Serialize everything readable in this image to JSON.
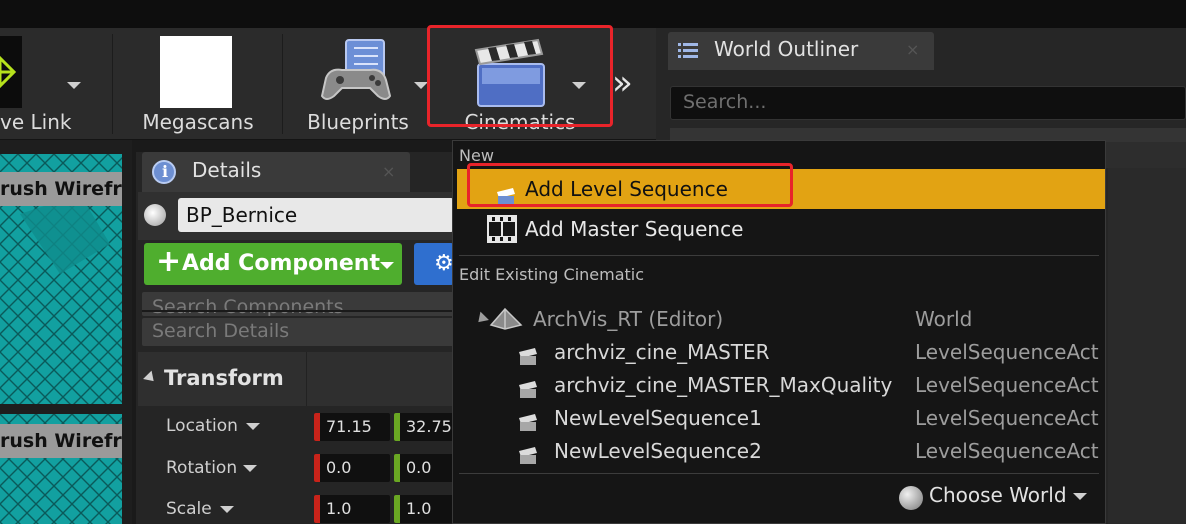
{
  "toolbar": {
    "live_link_label": "ve Link",
    "megascans_label": "Megascans",
    "blueprints_label": "Blueprints",
    "cinematics_label": "Cinematics",
    "overflow_glyph": "»"
  },
  "world_outliner": {
    "tab_label": "World Outliner",
    "search_placeholder": "Search...",
    "close_glyph": "×"
  },
  "viewport": {
    "label_1": "rush Wirefram",
    "label_2": "rush Wirefra"
  },
  "details": {
    "tab_label": "Details",
    "close_glyph": "×",
    "actor_name": "BP_Bernice",
    "add_component_plus": "+",
    "add_component_label": "Add Component",
    "search_components_placeholder": "Search Components",
    "search_details_placeholder": "Search Details",
    "transform_label": "Transform",
    "rows": [
      {
        "label": "Location",
        "x": "71.15",
        "y": "32.75"
      },
      {
        "label": "Rotation",
        "x": "0.0",
        "y": "0.0"
      },
      {
        "label": "Scale",
        "x": "1.0",
        "y": "1.0"
      }
    ]
  },
  "cinematics_menu": {
    "section_new": "New",
    "add_level_sequence": "Add Level Sequence",
    "add_master_sequence": "Add Master Sequence",
    "section_edit": "Edit Existing Cinematic",
    "world_row": {
      "name": "ArchVis_RT (Editor)",
      "type": "World"
    },
    "items": [
      {
        "name": "archviz_cine_MASTER",
        "type": "LevelSequenceAct"
      },
      {
        "name": "archviz_cine_MASTER_MaxQuality",
        "type": "LevelSequenceAct"
      },
      {
        "name": "NewLevelSequence1",
        "type": "LevelSequenceAct"
      },
      {
        "name": "NewLevelSequence2",
        "type": "LevelSequenceAct"
      }
    ],
    "choose_world_label": "Choose World"
  },
  "colors": {
    "highlight": "#e2a313",
    "annotation_red": "#e8242a",
    "add_component_green": "#4fae2e",
    "axis_x": "#c8231a",
    "axis_y": "#6aa723"
  }
}
